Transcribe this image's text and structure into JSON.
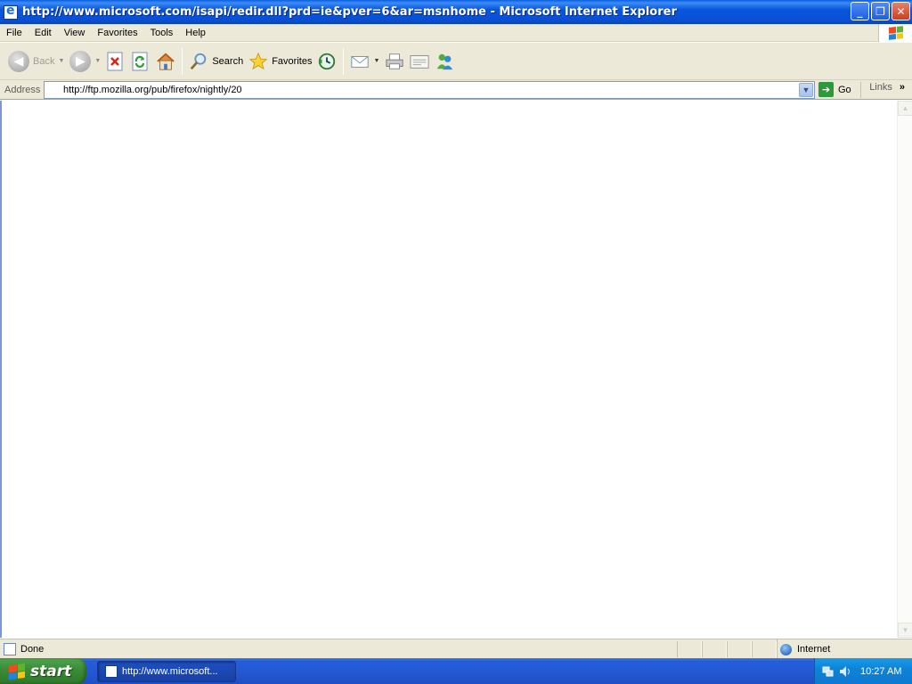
{
  "window": {
    "title": "http://www.microsoft.com/isapi/redir.dll?prd=ie&pver=6&ar=msnhome - Microsoft Internet Explorer",
    "controls": [
      "minimize",
      "maximize",
      "close"
    ]
  },
  "menubar": {
    "items": [
      "File",
      "Edit",
      "View",
      "Favorites",
      "Tools",
      "Help"
    ]
  },
  "toolbar": {
    "back_label": "Back",
    "search_label": "Search",
    "favorites_label": "Favorites"
  },
  "addressbar": {
    "label": "Address",
    "value": "http://ftp.mozilla.org/pub/firefox/nightly/20",
    "go_label": "Go",
    "links_label": "Links"
  },
  "statusbar": {
    "status": "Done",
    "zone": "Internet"
  },
  "taskbar": {
    "start_label": "start",
    "task_label": "http://www.microsoft...",
    "clock": "10:27 AM"
  },
  "colors": {
    "titlebar_blue": "#0a4fd3",
    "chrome_beige": "#ece9d8",
    "start_green": "#3a8b37",
    "tray_blue": "#0d84d8"
  },
  "icons": [
    "ie-page-icon",
    "windows-flag-icon",
    "back-icon",
    "forward-icon",
    "stop-icon",
    "refresh-icon",
    "home-icon",
    "search-icon",
    "favorites-icon",
    "history-icon",
    "mail-icon",
    "print-icon",
    "edit-icon",
    "messenger-icon",
    "go-icon",
    "globe-icon"
  ]
}
